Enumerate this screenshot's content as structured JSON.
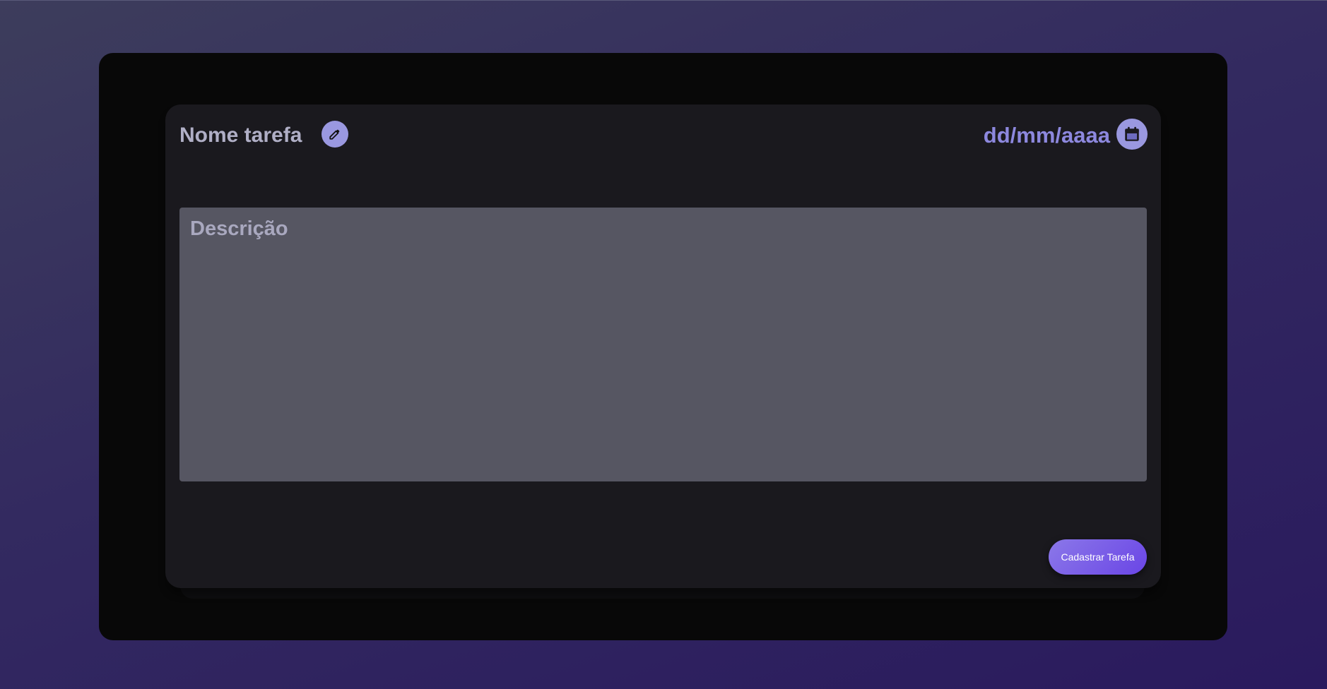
{
  "form": {
    "task_name_placeholder": "Nome tarefa",
    "date_placeholder": "dd/mm/aaaa",
    "description_placeholder": "Descrição",
    "submit_label": "Cadastrar Tarefa"
  },
  "icons": {
    "edit": "pencil-icon",
    "date": "calendar-icon"
  },
  "colors": {
    "accent": "#9a98e0",
    "date_text": "#8d88de",
    "button_gradient_start": "#8b78e8",
    "button_gradient_end": "#6a45e6",
    "card_background": "#1a191e",
    "panel_background": "#080808",
    "description_background": "#565662"
  }
}
